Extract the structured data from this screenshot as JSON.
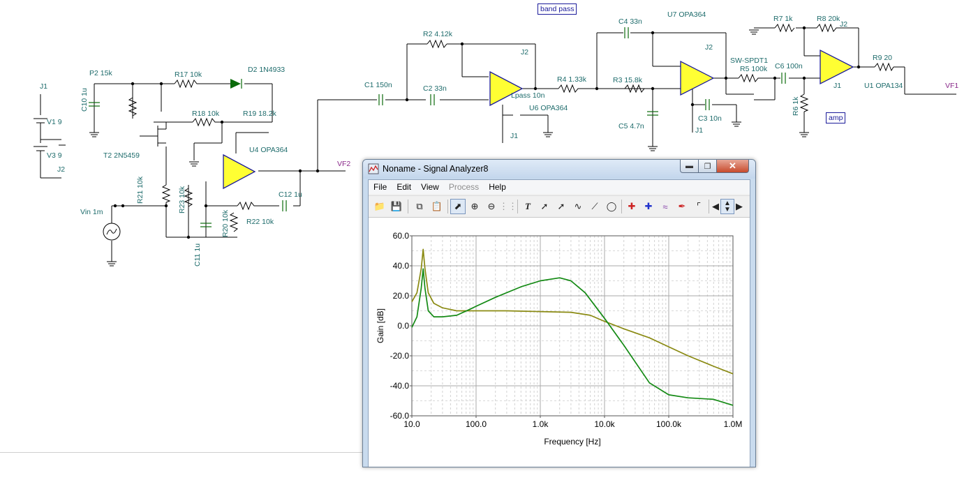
{
  "schematic": {
    "labels": {
      "P2": "P2 15k",
      "C10": "C10 1u",
      "R17": "R17 10k",
      "D2": "D2 1N4933",
      "R18": "R18 10k",
      "R19": "R19 18.2k",
      "V1": "V1 9",
      "V3": "V3 9",
      "J1a": "J1",
      "J2a": "J2",
      "T2": "T2 2N5459",
      "U4": "U4 OPA364",
      "R21": "R21 10k",
      "R23": "R23 10k",
      "Vin": "Vin 1m",
      "R20": "R20 10k",
      "R22": "R22 10k",
      "C11": "C11 1u",
      "C12": "C12 1u",
      "VF2": "VF2",
      "C1": "C1 150n",
      "R2": "R2 4.12k",
      "C2": "C2 33n",
      "J2b": "J2",
      "lpass": "Lpass 10n",
      "U6": "U6 OPA364",
      "J1b": "J1",
      "bandpass": "band pass",
      "C4": "C4 33n",
      "U7": "U7 OPA364",
      "R4": "R4 1.33k",
      "R3": "R3 15.8k",
      "J2c": "J2",
      "C5": "C5 4.7n",
      "C3": "C3 10n",
      "J1c": "J1",
      "SW": "SW-SPDT1",
      "R5": "R5 100k",
      "C6": "C6 100n",
      "R7": "R7 1k",
      "R8": "R8 20k",
      "J2d": "J2",
      "R6": "R6 1k",
      "amp": "amp",
      "R9": "R9 20",
      "U1": "U1 OPA134",
      "J1d": "J1",
      "VF1": "VF1"
    }
  },
  "window": {
    "title": "Noname - Signal Analyzer8",
    "menu": [
      "File",
      "Edit",
      "View",
      "Process",
      "Help"
    ],
    "disabled_menu": "Process",
    "toolbar_icons": [
      "open-icon",
      "save-icon",
      "copy-icon",
      "paste-icon",
      "pointer-icon",
      "zoom-in-icon",
      "zoom-out-icon",
      "grid-icon",
      "text-icon",
      "cursor-a-icon",
      "cursor-b-icon",
      "curve-icon",
      "line-icon",
      "circle-icon",
      "cursor-red-icon",
      "cursor-blue-icon",
      "waves-icon",
      "pen-icon",
      "step-icon",
      "arrow-left-icon",
      "arrow-updown-icon",
      "arrow-right-icon"
    ]
  },
  "chart_data": {
    "type": "line",
    "xlabel": "Frequency [Hz]",
    "ylabel": "Gain [dB]",
    "xscale": "log",
    "xlim": [
      10,
      1000000
    ],
    "ylim": [
      -60,
      60
    ],
    "xticks": [
      "10.0",
      "100.0",
      "1.0k",
      "10.0k",
      "100.0k",
      "1.0M"
    ],
    "yticks": [
      "60.0",
      "40.0",
      "20.0",
      "0.0",
      "-20.0",
      "-40.0",
      "-60.0"
    ],
    "grid": true,
    "series": [
      {
        "color": "#8a8a12",
        "x": [
          10,
          12,
          14,
          15,
          16,
          18,
          22,
          30,
          50,
          80,
          100,
          300,
          1000,
          3000,
          6000,
          10000,
          20000,
          50000,
          100000,
          200000,
          500000,
          1000000
        ],
        "y": [
          16,
          22,
          38,
          51,
          38,
          22,
          15,
          12,
          10,
          10,
          10,
          10,
          9.5,
          9,
          7,
          3,
          -2,
          -8,
          -14,
          -20,
          -27,
          -32
        ]
      },
      {
        "color": "#148a14",
        "x": [
          10,
          12,
          14,
          15,
          16,
          18,
          22,
          30,
          50,
          80,
          100,
          200,
          500,
          1000,
          2000,
          3000,
          5000,
          10000,
          20000,
          50000,
          100000,
          200000,
          500000,
          1000000
        ],
        "y": [
          -1,
          6,
          25,
          38,
          25,
          10,
          6,
          6,
          7,
          11,
          13,
          19,
          26,
          30,
          32,
          30,
          22,
          5,
          -13,
          -38,
          -46,
          -48,
          -49,
          -53
        ]
      }
    ]
  },
  "colors": {
    "trace1": "#8a8a12",
    "trace2": "#148a14",
    "amp_fill": "#ffff33"
  }
}
